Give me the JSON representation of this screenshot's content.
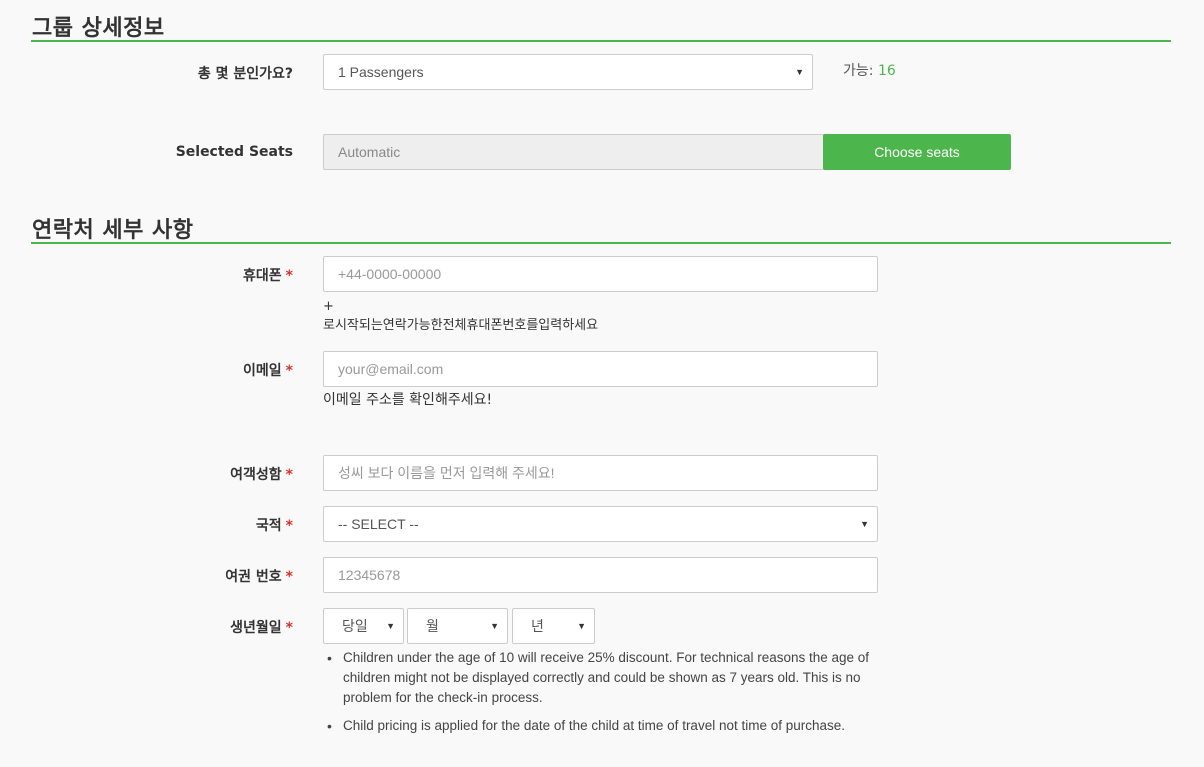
{
  "group_section": {
    "title": "그룹 상세정보",
    "passengers_label": "총 몇 분인가요?",
    "passengers_value": "1 Passengers",
    "available_label": "가능:",
    "available_count": "16",
    "seats_label": "Selected Seats",
    "seats_value": "Automatic",
    "choose_seats_button": "Choose seats"
  },
  "contact_section": {
    "title": "연락처 세부 사항",
    "phone_label": "휴대폰",
    "phone_placeholder": "+44-0000-00000",
    "phone_help_line1": "+",
    "phone_help_line2": "로시작되는연락가능한전체휴대폰번호를입력하세요",
    "email_label": "이메일",
    "email_placeholder": "your@email.com",
    "email_help": "이메일 주소를 확인해주세요!",
    "name_label": "여객성함",
    "name_placeholder": "성씨 보다 이름을 먼저 입력해 주세요!",
    "nationality_label": "국적",
    "nationality_value": "-- SELECT --",
    "passport_label": "여권 번호",
    "passport_placeholder": "12345678",
    "birth_label": "생년월일",
    "birth_day": "당일",
    "birth_month": "월",
    "birth_year": "년",
    "required_mark": "*",
    "notes": [
      "Children under the age of 10 will receive 25% discount. For technical reasons the age of children might not be displayed correctly and could be shown as 7 years old. This is no problem for the check-in process.",
      "Child pricing is applied for the date of the child at time of travel not time of purchase."
    ]
  },
  "colors": {
    "accent": "#4cb64c",
    "required": "#d9312b"
  }
}
